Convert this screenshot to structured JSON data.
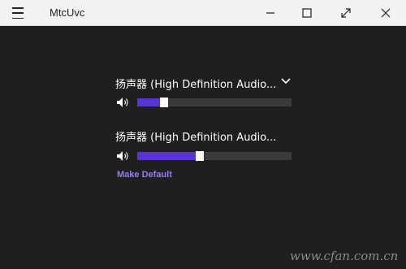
{
  "window": {
    "title": "MtcUvc",
    "menu_icon": "hamburger-icon",
    "controls": [
      "minimize-icon",
      "maximize-icon",
      "fullscreen-icon",
      "close-icon"
    ]
  },
  "devices": [
    {
      "name": "扬声器 (High Definition Audio...",
      "volume_fraction": 0.17,
      "has_dropdown": true,
      "icon": "speaker-icon"
    },
    {
      "name": "扬声器 (High Definition Audio...",
      "volume_fraction": 0.4,
      "make_default_label": "Make Default",
      "icon": "speaker-icon"
    }
  ],
  "colors": {
    "background": "#1f1f1f",
    "titlebar": "#f2f2f2",
    "accent": "#5a33d6",
    "link": "#9a7cf0",
    "track": "#3a3a3a"
  },
  "watermark": "www.cfan.com.cn"
}
